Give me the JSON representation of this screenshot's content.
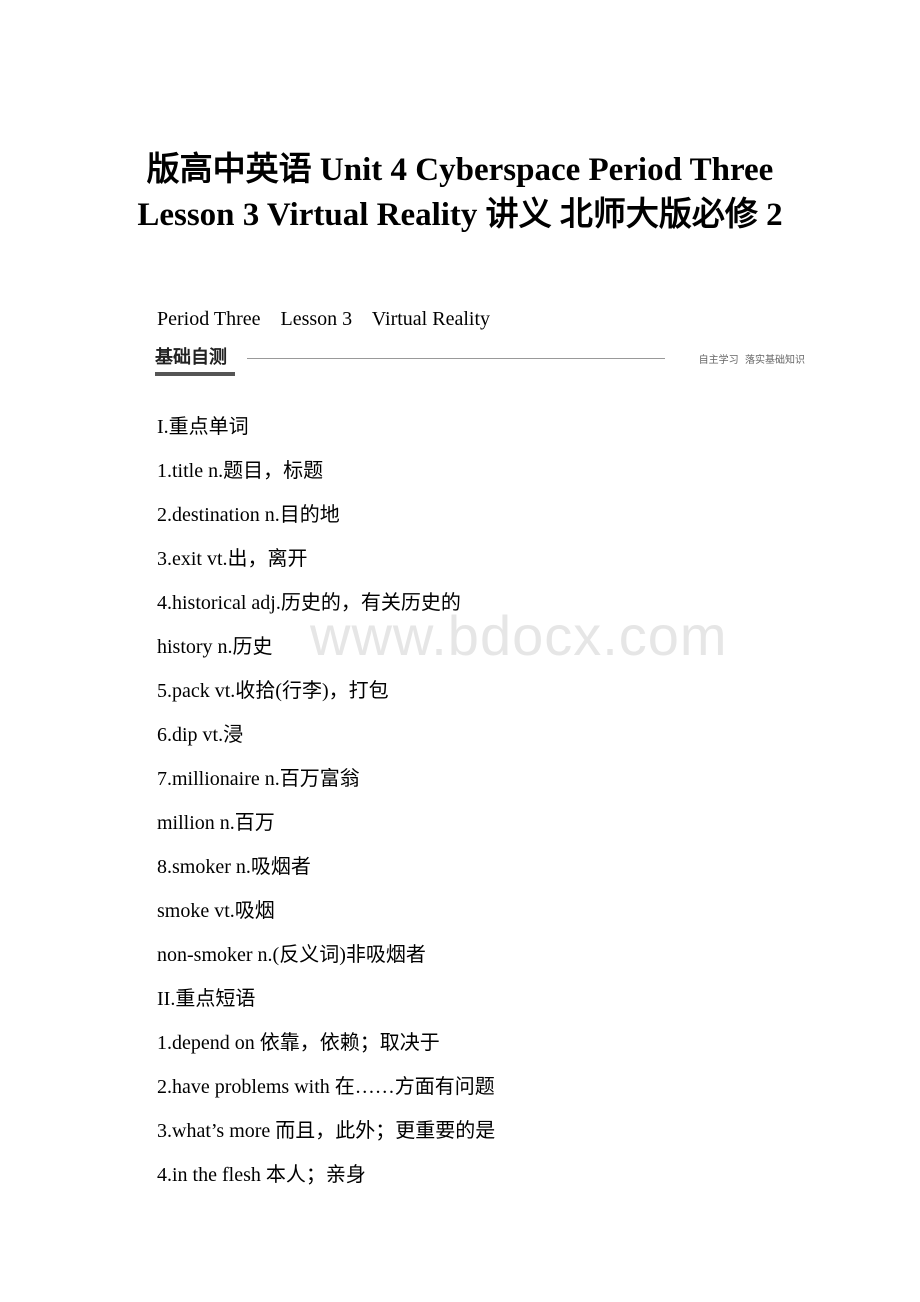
{
  "document": {
    "title_line1": "版高中英语 Unit 4 Cyberspace Period Three",
    "title_line2": "Lesson 3 Virtual Reality 讲义 北师大版必修 2",
    "subheading": "Period Three    Lesson 3    Virtual Reality",
    "banner": {
      "label": "基础自测",
      "tag": "自主学习  落实基础知识"
    },
    "watermark": "www.bdocx.com",
    "lines": [
      "I.重点单词",
      "1.title n.题目，标题",
      "2.destination n.目的地",
      "3.exit vt.出，离开",
      "4.historical adj.历史的，有关历史的",
      "history n.历史",
      "5.pack vt.收拾(行李)，打包",
      "6.dip vt.浸",
      "7.millionaire n.百万富翁",
      "million n.百万",
      "8.smoker n.吸烟者",
      "smoke vt.吸烟",
      "non-smoker n.(反义词)非吸烟者",
      "II.重点短语",
      "1.depend on 依靠，依赖；取决于",
      "2.have problems with 在……方面有问题",
      "3.what’s more 而且，此外；更重要的是",
      "4.in the flesh 本人；亲身"
    ]
  }
}
